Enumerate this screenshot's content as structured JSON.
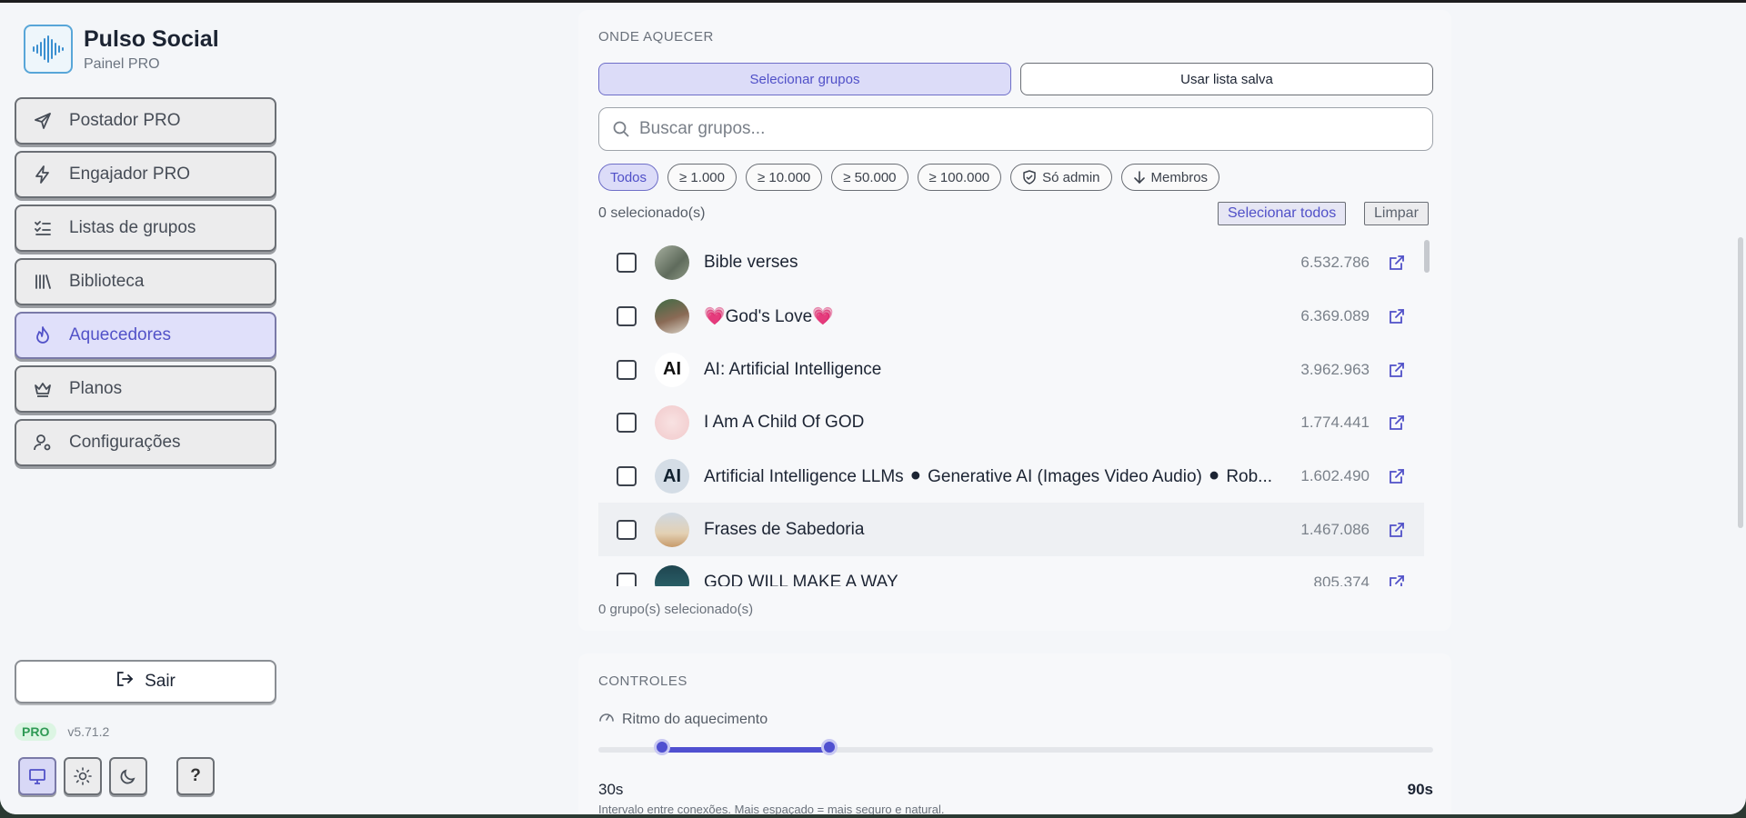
{
  "brand": {
    "title": "Pulso Social",
    "subtitle": "Painel PRO"
  },
  "nav": [
    {
      "label": "Postador PRO",
      "icon": "send-icon"
    },
    {
      "label": "Engajador PRO",
      "icon": "bolt-icon"
    },
    {
      "label": "Listas de grupos",
      "icon": "list-check-icon"
    },
    {
      "label": "Biblioteca",
      "icon": "library-icon"
    },
    {
      "label": "Aquecedores",
      "icon": "flame-icon",
      "active": true
    },
    {
      "label": "Planos",
      "icon": "crown-icon"
    },
    {
      "label": "Configurações",
      "icon": "user-gear-icon"
    }
  ],
  "logout_label": "Sair",
  "badge": "PRO",
  "version": "v5.71.2",
  "help_label": "?",
  "warm": {
    "section_title": "ONDE AQUECER",
    "tab_select": "Selecionar grupos",
    "tab_saved": "Usar lista salva",
    "search_placeholder": "Buscar grupos...",
    "chips": [
      "Todos",
      "≥ 1.000",
      "≥ 10.000",
      "≥ 50.000",
      "≥ 100.000",
      "Só admin",
      "Membros"
    ],
    "selected_count": "0 selecionado(s)",
    "select_all": "Selecionar todos",
    "clear": "Limpar",
    "groups": [
      {
        "name": "Bible verses",
        "members": "6.532.786"
      },
      {
        "name": "💗God's Love💗",
        "members": "6.369.089"
      },
      {
        "name": "AI: Artificial Intelligence",
        "members": "3.962.963",
        "avatar_text": "AI"
      },
      {
        "name": "I Am A Child Of GOD",
        "members": "1.774.441"
      },
      {
        "name": "Artificial Intelligence LLMs ⚫ Generative AI (Images Video Audio) ⚫ Rob...",
        "members": "1.602.490",
        "avatar_text": "AI"
      },
      {
        "name": "Frases de Sabedoria",
        "members": "1.467.086"
      },
      {
        "name": "GOD WILL MAKE A WAY",
        "members": "805.374"
      }
    ],
    "footer_count": "0 grupo(s) selecionado(s)"
  },
  "controls": {
    "section_title": "CONTROLES",
    "rhythm_label": "Ritmo do aquecimento",
    "min_label": "30s",
    "max_label": "90s",
    "range_low": 0.08,
    "range_high": 0.28,
    "hint": "Intervalo entre conexões. Mais espaçado = mais seguro e natural."
  },
  "colors": {
    "accent": "#5050d0",
    "active_bg": "#dcdcf8",
    "pro_green": "#2f9a55"
  }
}
